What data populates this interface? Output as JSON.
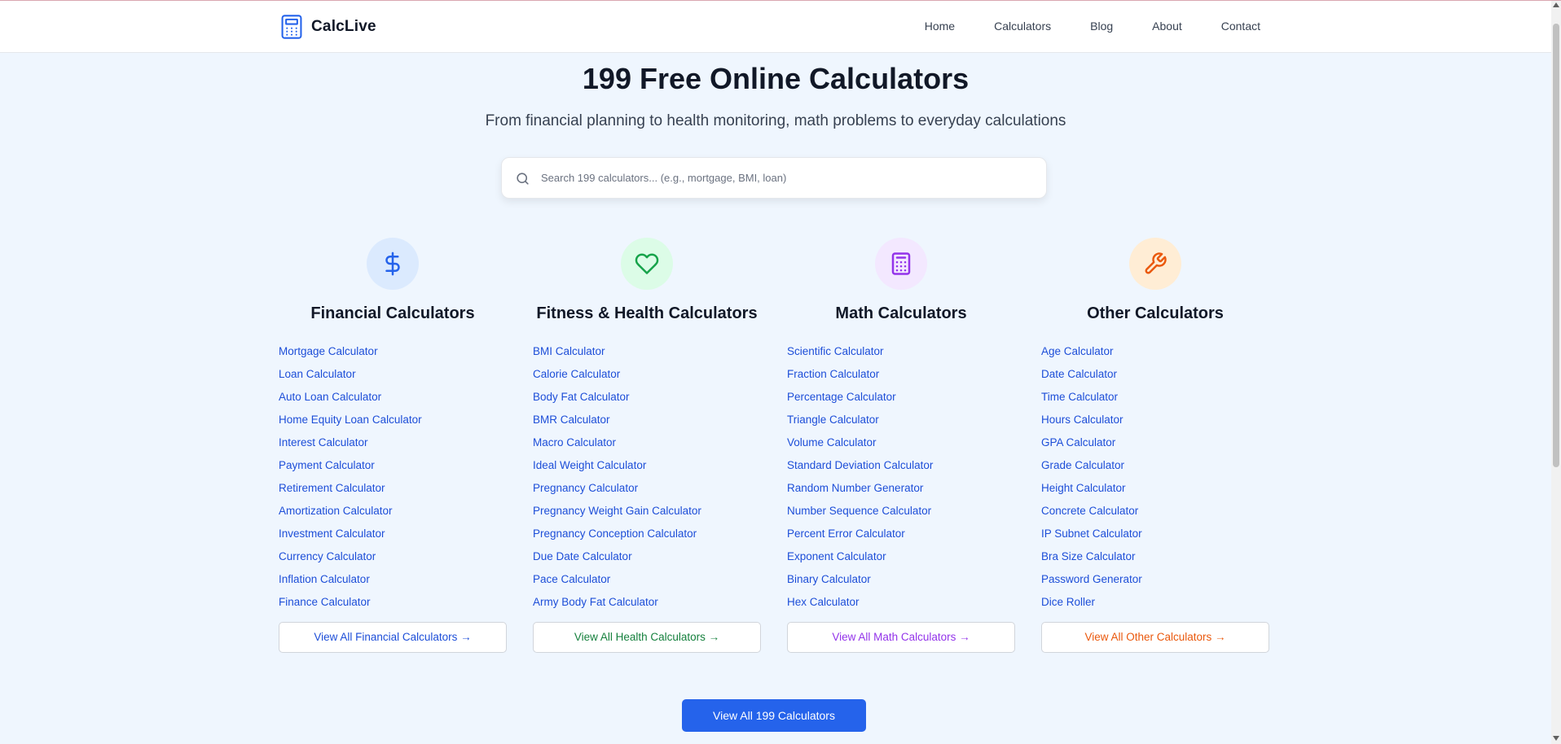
{
  "brand": {
    "name": "CalcLive",
    "icon": "calculator-icon",
    "color": "#2563eb"
  },
  "nav": [
    {
      "label": "Home"
    },
    {
      "label": "Calculators"
    },
    {
      "label": "Blog"
    },
    {
      "label": "About"
    },
    {
      "label": "Contact"
    }
  ],
  "hero": {
    "title": "199 Free Online Calculators",
    "subtitle": "From financial planning to health monitoring, math problems to everyday calculations"
  },
  "search": {
    "placeholder": "Search 199 calculators... (e.g., mortgage, BMI, loan)",
    "value": "",
    "icon": "search-icon"
  },
  "categories": [
    {
      "title": "Financial Calculators",
      "icon": "dollar-icon",
      "icon_color": "#2563eb",
      "icon_bg": "#dbeafe",
      "links": [
        "Mortgage Calculator",
        "Loan Calculator",
        "Auto Loan Calculator",
        "Home Equity Loan Calculator",
        "Interest Calculator",
        "Payment Calculator",
        "Retirement Calculator",
        "Amortization Calculator",
        "Investment Calculator",
        "Currency Calculator",
        "Inflation Calculator",
        "Finance Calculator"
      ],
      "view_all": "View All Financial Calculators →",
      "view_color": "#1d4ed8"
    },
    {
      "title": "Fitness & Health Calculators",
      "icon": "heart-icon",
      "icon_color": "#16a34a",
      "icon_bg": "#dcfce7",
      "links": [
        "BMI Calculator",
        "Calorie Calculator",
        "Body Fat Calculator",
        "BMR Calculator",
        "Macro Calculator",
        "Ideal Weight Calculator",
        "Pregnancy Calculator",
        "Pregnancy Weight Gain Calculator",
        "Pregnancy Conception Calculator",
        "Due Date Calculator",
        "Pace Calculator",
        "Army Body Fat Calculator"
      ],
      "view_all": "View All Health Calculators →",
      "view_color": "#15803d"
    },
    {
      "title": "Math Calculators",
      "icon": "calculator-icon",
      "icon_color": "#9333ea",
      "icon_bg": "#f3e8ff",
      "links": [
        "Scientific Calculator",
        "Fraction Calculator",
        "Percentage Calculator",
        "Triangle Calculator",
        "Volume Calculator",
        "Standard Deviation Calculator",
        "Random Number Generator",
        "Number Sequence Calculator",
        "Percent Error Calculator",
        "Exponent Calculator",
        "Binary Calculator",
        "Hex Calculator"
      ],
      "view_all": "View All Math Calculators →",
      "view_color": "#9333ea"
    },
    {
      "title": "Other Calculators",
      "icon": "wrench-icon",
      "icon_color": "#ea580c",
      "icon_bg": "#ffedd5",
      "links": [
        "Age Calculator",
        "Date Calculator",
        "Time Calculator",
        "Hours Calculator",
        "GPA Calculator",
        "Grade Calculator",
        "Height Calculator",
        "Concrete Calculator",
        "IP Subnet Calculator",
        "Bra Size Calculator",
        "Password Generator",
        "Dice Roller"
      ],
      "view_all": "View All Other Calculators →",
      "view_color": "#ea580c"
    }
  ],
  "cta": {
    "label": "View All 199 Calculators"
  }
}
